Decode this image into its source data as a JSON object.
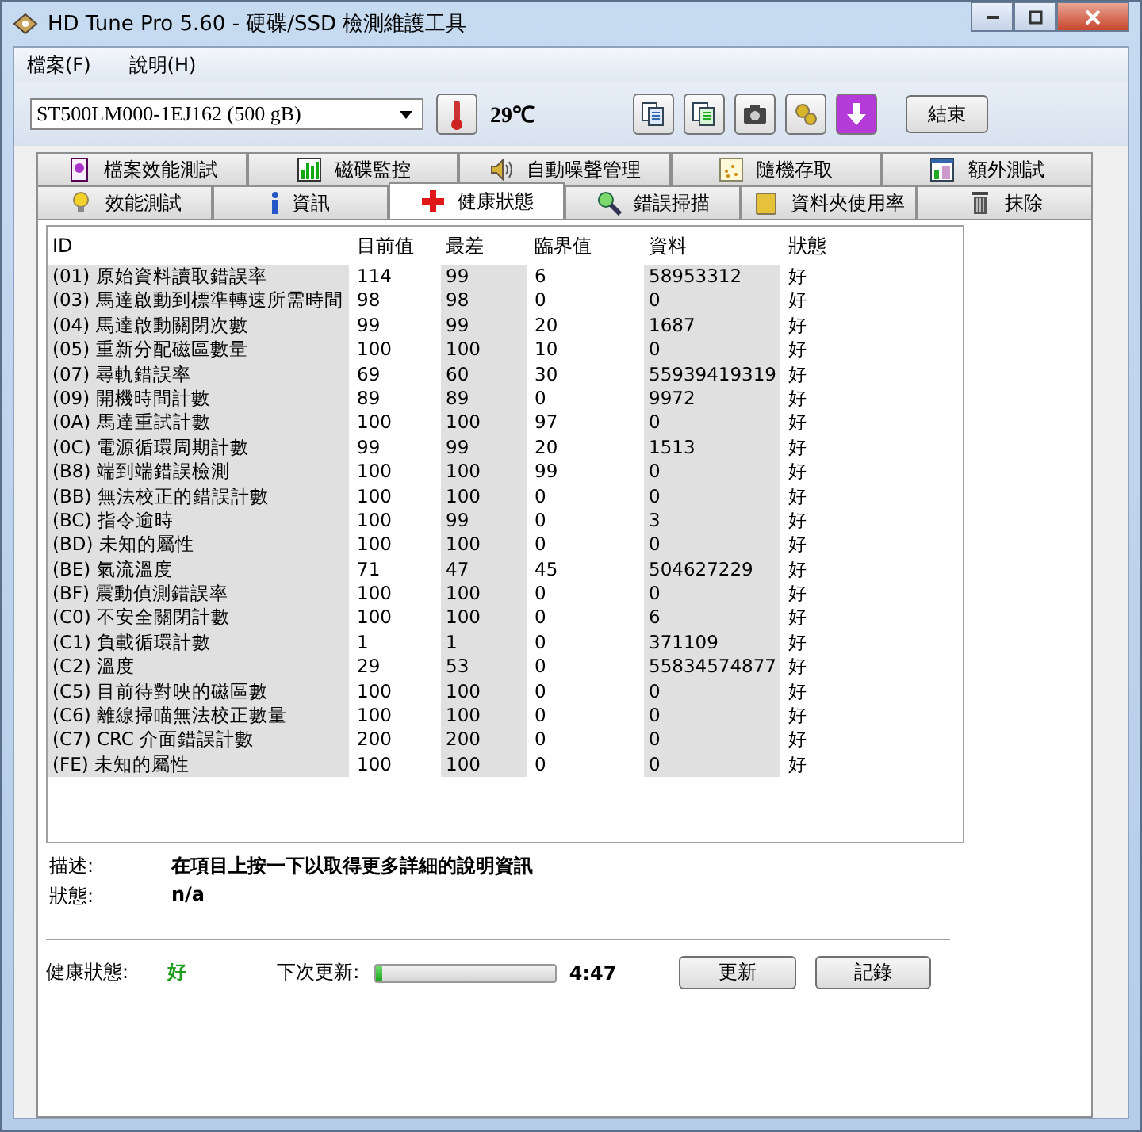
{
  "window": {
    "title": "HD Tune Pro 5.60 - 硬碟/SSD 檢測維護工具"
  },
  "menu": [
    "檔案(F)",
    "說明(H)"
  ],
  "toolbar": {
    "drive": "ST500LM000-1EJ162 (500 gB)",
    "temperature": "29℃",
    "exit_button": "結束"
  },
  "tabs_back": [
    {
      "label": "檔案效能測試",
      "selected": false
    },
    {
      "label": "磁碟監控",
      "selected": false
    },
    {
      "label": "自動噪聲管理",
      "selected": false
    },
    {
      "label": "隨機存取",
      "selected": false
    },
    {
      "label": "額外測試",
      "selected": false
    }
  ],
  "tabs_front": [
    {
      "label": "效能測試",
      "selected": false
    },
    {
      "label": "資訊",
      "selected": false
    },
    {
      "label": "健康狀態",
      "selected": true
    },
    {
      "label": "錯誤掃描",
      "selected": false
    },
    {
      "label": "資料夾使用率",
      "selected": false
    },
    {
      "label": "抹除",
      "selected": false
    }
  ],
  "table": {
    "columns": [
      "ID",
      "目前值",
      "最差",
      "臨界值",
      "資料",
      "狀態"
    ],
    "rows": [
      [
        "(01) 原始資料讀取錯誤率",
        "114",
        "99",
        "6",
        "58953312",
        "好"
      ],
      [
        "(03) 馬達啟動到標準轉速所需時間",
        "98",
        "98",
        "0",
        "0",
        "好"
      ],
      [
        "(04) 馬達啟動關閉次數",
        "99",
        "99",
        "20",
        "1687",
        "好"
      ],
      [
        "(05) 重新分配磁區數量",
        "100",
        "100",
        "10",
        "0",
        "好"
      ],
      [
        "(07) 尋軌錯誤率",
        "69",
        "60",
        "30",
        "55939419319",
        "好"
      ],
      [
        "(09) 開機時間計數",
        "89",
        "89",
        "0",
        "9972",
        "好"
      ],
      [
        "(0A) 馬達重試計數",
        "100",
        "100",
        "97",
        "0",
        "好"
      ],
      [
        "(0C) 電源循環周期計數",
        "99",
        "99",
        "20",
        "1513",
        "好"
      ],
      [
        "(B8) 端到端錯誤檢測",
        "100",
        "100",
        "99",
        "0",
        "好"
      ],
      [
        "(BB) 無法校正的錯誤計數",
        "100",
        "100",
        "0",
        "0",
        "好"
      ],
      [
        "(BC) 指令逾時",
        "100",
        "99",
        "0",
        "3",
        "好"
      ],
      [
        "(BD) 未知的屬性",
        "100",
        "100",
        "0",
        "0",
        "好"
      ],
      [
        "(BE) 氣流溫度",
        "71",
        "47",
        "45",
        "504627229",
        "好"
      ],
      [
        "(BF) 震動偵測錯誤率",
        "100",
        "100",
        "0",
        "0",
        "好"
      ],
      [
        "(C0) 不安全關閉計數",
        "100",
        "100",
        "0",
        "6",
        "好"
      ],
      [
        "(C1) 負載循環計數",
        "1",
        "1",
        "0",
        "371109",
        "好"
      ],
      [
        "(C2) 溫度",
        "29",
        "53",
        "0",
        "55834574877",
        "好"
      ],
      [
        "(C5) 目前待對映的磁區數",
        "100",
        "100",
        "0",
        "0",
        "好"
      ],
      [
        "(C6) 離線掃瞄無法校正數量",
        "100",
        "100",
        "0",
        "0",
        "好"
      ],
      [
        "(C7) CRC 介面錯誤計數",
        "200",
        "200",
        "0",
        "0",
        "好"
      ],
      [
        "(FE) 未知的屬性",
        "100",
        "100",
        "0",
        "0",
        "好"
      ]
    ]
  },
  "details": [
    {
      "label": "描述:",
      "value": "在項目上按一下以取得更多詳細的說明資訊"
    },
    {
      "label": "狀態:",
      "value": "n/a"
    }
  ],
  "footer": {
    "health_label": "健康狀態:",
    "health_value": "好",
    "next_update_label": "下次更新:",
    "next_update": {
      "level": 0.04
    },
    "time": "4:47",
    "refresh_button": "更新",
    "log_button": "記錄"
  }
}
